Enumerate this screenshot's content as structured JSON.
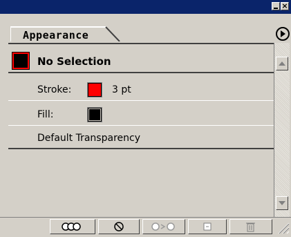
{
  "panel": {
    "tab_label": "Appearance"
  },
  "header": {
    "title": "No Selection"
  },
  "attributes": [
    {
      "label": "Stroke:",
      "color": "#ff0000",
      "value": "3 pt"
    },
    {
      "label": "Fill:",
      "color": "#000000"
    },
    {
      "label": "Default Transparency"
    }
  ],
  "toolbar": {
    "buttons": [
      {
        "icon": "new-art-maintains-appearance-icon"
      },
      {
        "icon": "clear-appearance-icon"
      },
      {
        "icon": "reduce-to-basic-appearance-icon"
      },
      {
        "icon": "duplicate-item-icon"
      },
      {
        "icon": "delete-item-icon"
      }
    ]
  },
  "colors": {
    "title_bar": "#0a246a",
    "chrome": "#d4d0c8",
    "stroke_swatch": "#ff0000",
    "fill_swatch": "#000000"
  }
}
